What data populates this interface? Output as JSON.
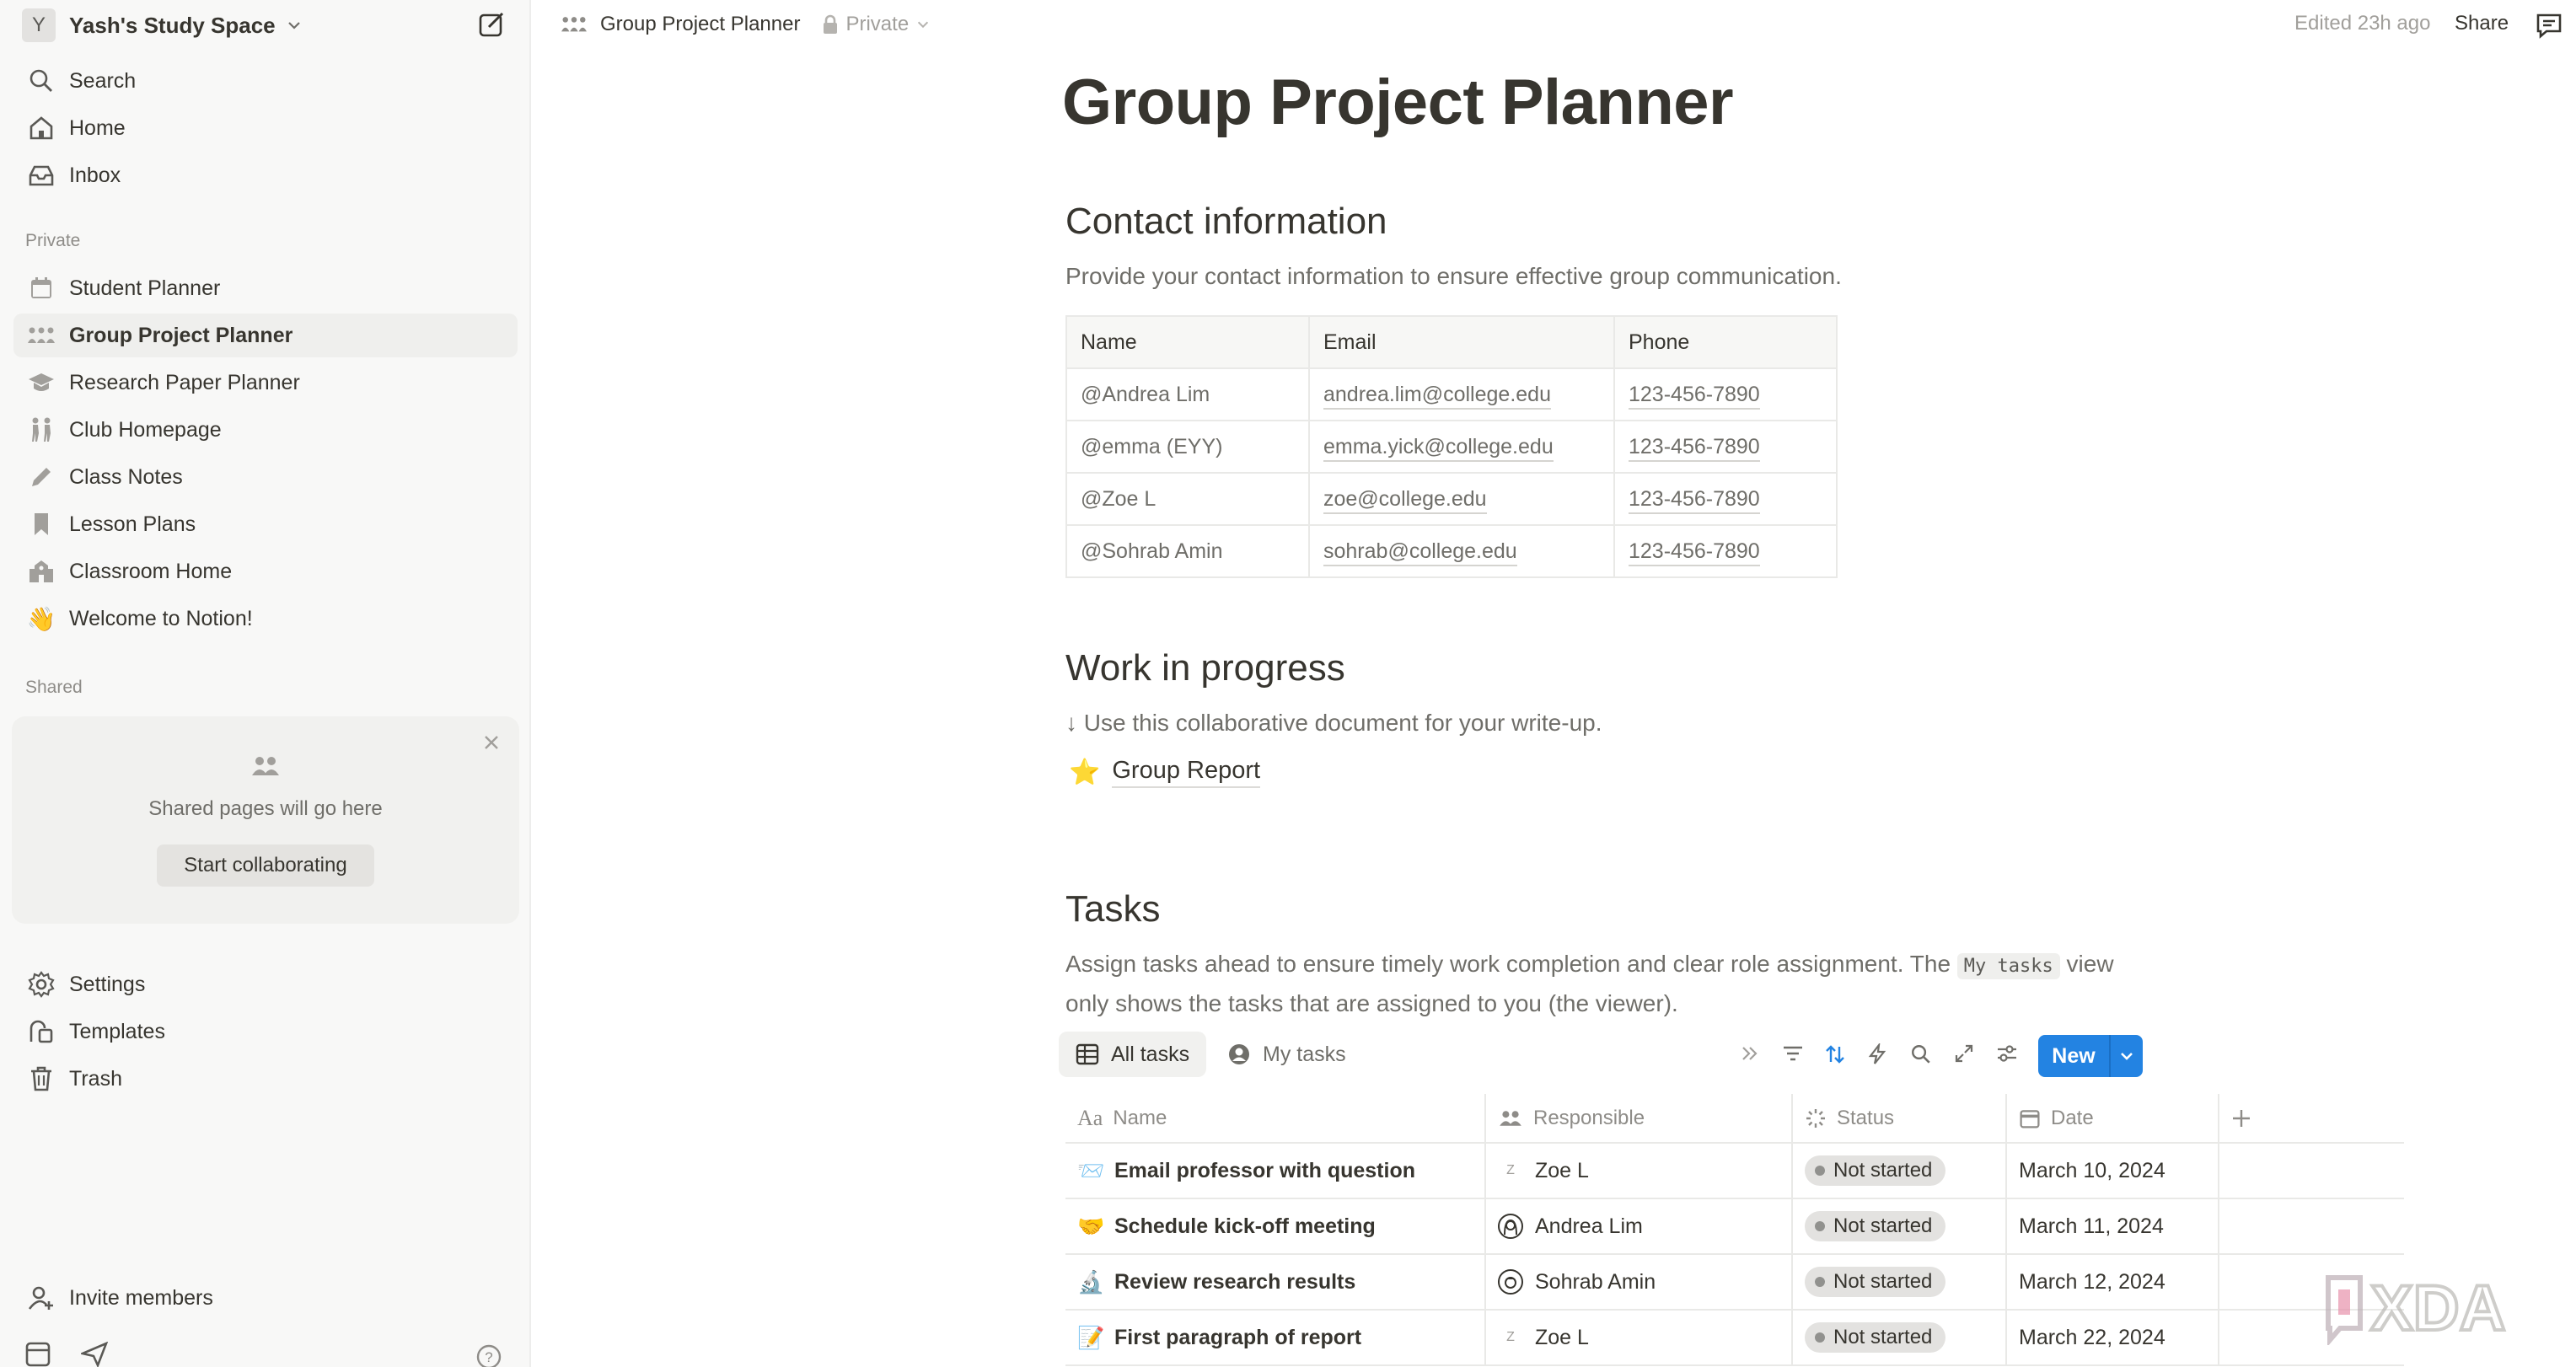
{
  "workspace": {
    "avatar_letter": "Y",
    "name": "Yash's Study Space"
  },
  "sidebar": {
    "nav": [
      {
        "label": "Search",
        "icon": "search-icon"
      },
      {
        "label": "Home",
        "icon": "home-icon"
      },
      {
        "label": "Inbox",
        "icon": "inbox-icon"
      }
    ],
    "private_label": "Private",
    "pages": [
      {
        "label": "Student Planner",
        "icon": "calendar-icon"
      },
      {
        "label": "Group Project Planner",
        "icon": "group-icon"
      },
      {
        "label": "Research Paper Planner",
        "icon": "graduation-cap-icon"
      },
      {
        "label": "Club Homepage",
        "icon": "people-walking-icon"
      },
      {
        "label": "Class Notes",
        "icon": "pencil-icon"
      },
      {
        "label": "Lesson Plans",
        "icon": "bookmark-icon"
      },
      {
        "label": "Classroom Home",
        "icon": "school-icon"
      },
      {
        "label": "Welcome to Notion!",
        "icon": "waving-hand-icon"
      }
    ],
    "shared_label": "Shared",
    "shared_empty_text": "Shared pages will go here",
    "collab_button": "Start collaborating",
    "bottom": [
      {
        "label": "Settings",
        "icon": "gear-icon"
      },
      {
        "label": "Templates",
        "icon": "templates-icon"
      },
      {
        "label": "Trash",
        "icon": "trash-icon"
      }
    ],
    "invite": "Invite members"
  },
  "topbar": {
    "breadcrumb_title": "Group Project Planner",
    "privacy": "Private",
    "edited": "Edited 23h ago",
    "share": "Share"
  },
  "page": {
    "title": "Group Project Planner",
    "contact": {
      "heading": "Contact information",
      "desc": "Provide your contact information to ensure effective group communication.",
      "columns": [
        "Name",
        "Email",
        "Phone"
      ],
      "rows": [
        {
          "name": "@Andrea Lim",
          "email": "andrea.lim@college.edu",
          "phone": "123-456-7890"
        },
        {
          "name": "@emma (EYY)",
          "email": "emma.yick@college.edu",
          "phone": "123-456-7890"
        },
        {
          "name": "@Zoe L",
          "email": "zoe@college.edu",
          "phone": "123-456-7890"
        },
        {
          "name": "@Sohrab Amin",
          "email": "sohrab@college.edu",
          "phone": "123-456-7890"
        }
      ]
    },
    "wip": {
      "heading": "Work in progress",
      "desc": "↓ Use this collaborative document for your write-up.",
      "link_emoji": "⭐",
      "link": "Group Report"
    },
    "tasks": {
      "heading": "Tasks",
      "desc_before": "Assign tasks ahead to ensure timely work completion and clear role assignment. The",
      "desc_code": "My tasks",
      "desc_after": "view only shows the tasks that are assigned to you (the viewer).",
      "views": [
        "All tasks",
        "My tasks"
      ],
      "new_button": "New",
      "columns": [
        "Name",
        "Responsible",
        "Status",
        "Date"
      ],
      "rows": [
        {
          "emoji": "📨",
          "name": "Email professor with question",
          "avatar": "Z",
          "person": "Zoe L",
          "status": "Not started",
          "date": "March 10, 2024"
        },
        {
          "emoji": "🤝",
          "name": "Schedule kick-off meeting",
          "avatar": "",
          "person": "Andrea Lim",
          "status": "Not started",
          "date": "March 11, 2024"
        },
        {
          "emoji": "🔬",
          "name": "Review research results",
          "avatar": "",
          "person": "Sohrab Amin",
          "status": "Not started",
          "date": "March 12, 2024"
        },
        {
          "emoji": "📝",
          "name": "First paragraph of report",
          "avatar": "Z",
          "person": "Zoe L",
          "status": "Not started",
          "date": "March 22, 2024"
        }
      ]
    }
  },
  "watermark": "XDA"
}
